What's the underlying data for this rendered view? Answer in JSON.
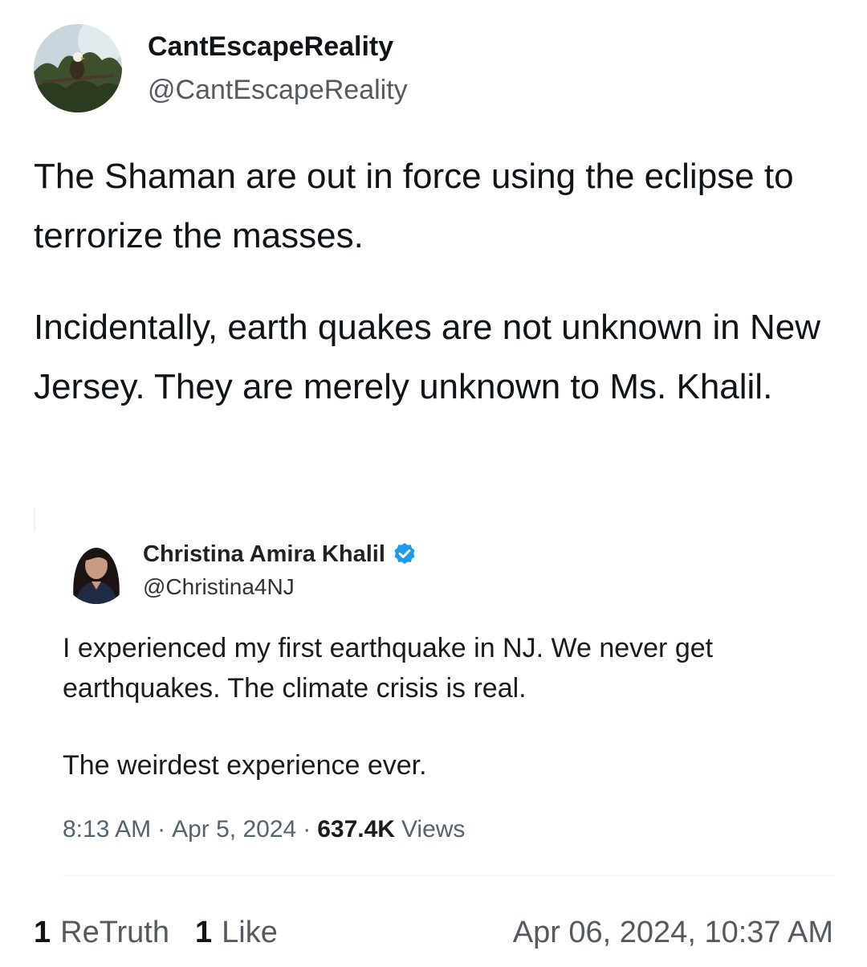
{
  "post": {
    "display_name": "CantEscapeReality",
    "handle": "@CantEscapeReality",
    "avatar_icon": "eagle-avatar",
    "paragraphs": [
      "The Shaman are out in force using the eclipse to terrorize the masses.",
      "Incidentally, earth quakes are not unknown in New Jersey.  They are merely unknown to Ms. Khalil."
    ]
  },
  "quoted": {
    "display_name": "Christina Amira Khalil",
    "handle": "@Christina4NJ",
    "avatar_icon": "person-avatar",
    "verified_icon": "verified-badge-icon",
    "verified_color": "#1d9bf0",
    "paragraphs": [
      "I experienced my first earthquake in NJ. We never get earthquakes. The climate crisis is real.",
      "The weirdest experience ever."
    ],
    "time": "8:13 AM",
    "separator": "·",
    "date": "Apr 5, 2024",
    "views_count": "637.4K",
    "views_label": "Views"
  },
  "footer": {
    "retruth_count": "1",
    "retruth_label": "ReTruth",
    "like_count": "1",
    "like_label": "Like",
    "timestamp": "Apr 06, 2024, 10:37 AM"
  }
}
